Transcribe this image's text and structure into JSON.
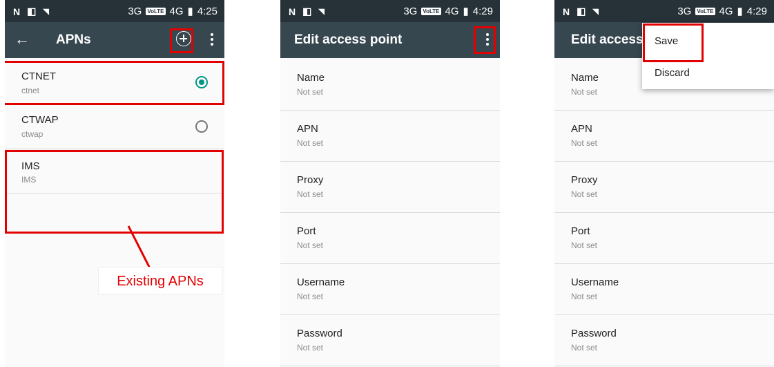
{
  "screens": [
    {
      "status": {
        "icons": [
          "N",
          "◧",
          "wifi-icon"
        ],
        "network": "3G",
        "volte": "VoLTE",
        "network2": "4G",
        "time": "4:25"
      },
      "title": "APNs",
      "apns": [
        {
          "name": "CTNET",
          "apn": "ctnet",
          "selected": true
        },
        {
          "name": "CTWAP",
          "apn": "ctwap",
          "selected": false
        },
        {
          "name": "IMS",
          "apn": "IMS"
        }
      ],
      "annotation": "Existing APNs"
    },
    {
      "status": {
        "icons": [
          "N",
          "◧",
          "wifi-icon"
        ],
        "network": "3G",
        "volte": "VoLTE",
        "network2": "4G",
        "time": "4:29"
      },
      "title": "Edit access point",
      "fields": [
        {
          "label": "Name",
          "value": "Not set"
        },
        {
          "label": "APN",
          "value": "Not set"
        },
        {
          "label": "Proxy",
          "value": "Not set"
        },
        {
          "label": "Port",
          "value": "Not set"
        },
        {
          "label": "Username",
          "value": "Not set"
        },
        {
          "label": "Password",
          "value": "Not set"
        }
      ]
    },
    {
      "status": {
        "icons": [
          "N",
          "◧",
          "wifi-icon"
        ],
        "network": "3G",
        "volte": "VoLTE",
        "network2": "4G",
        "time": "4:29"
      },
      "title": "Edit access",
      "menu": [
        "Save",
        "Discard"
      ],
      "fields": [
        {
          "label": "Name",
          "value": "Not set"
        },
        {
          "label": "APN",
          "value": "Not set"
        },
        {
          "label": "Proxy",
          "value": "Not set"
        },
        {
          "label": "Port",
          "value": "Not set"
        },
        {
          "label": "Username",
          "value": "Not set"
        },
        {
          "label": "Password",
          "value": "Not set"
        }
      ]
    }
  ],
  "colors": {
    "statusbar": "#263238",
    "appbar": "#37474f",
    "accent": "#009688",
    "highlight": "#e30000"
  }
}
